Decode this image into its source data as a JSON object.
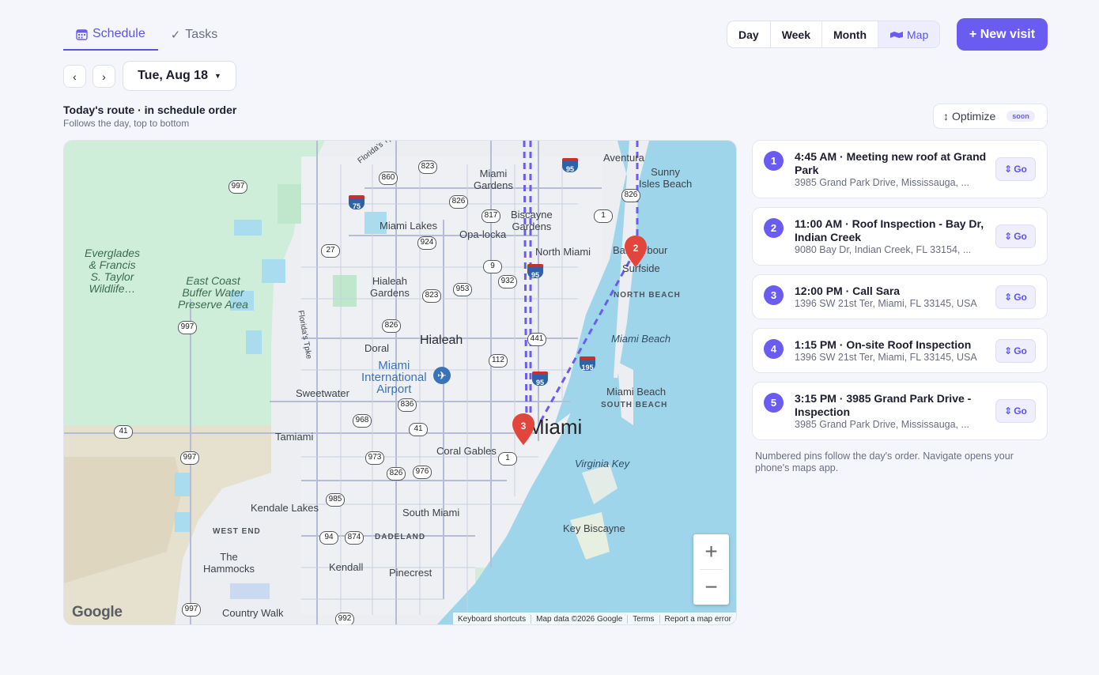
{
  "tabs": [
    {
      "label": "Schedule",
      "icon": "calendar-icon",
      "active": true
    },
    {
      "label": "Tasks",
      "icon": "check-icon",
      "active": false
    }
  ],
  "views": [
    {
      "label": "Day"
    },
    {
      "label": "Week"
    },
    {
      "label": "Month"
    },
    {
      "label": "Map",
      "icon": "map-icon",
      "active": true
    }
  ],
  "new_visit_label": "+ New visit",
  "date": {
    "label": "Tue, Aug 18",
    "prev": "‹",
    "next": "›"
  },
  "route": {
    "title": "Today's route · in schedule order",
    "subtitle": "Follows the day, top to bottom"
  },
  "optimize": {
    "label": "Optimize",
    "badge": "soon"
  },
  "map": {
    "labels": {
      "everglades": "Everglades\n& Francis\nS. Taylor\nWildlife…",
      "east_coast": "East Coast\nBuffer Water\nPreserve Area",
      "miami_gardens": "Miami\nGardens",
      "biscayne_gardens": "Biscayne\nGardens",
      "aventura": "Aventura",
      "sunny_isles": "Sunny\nIsles Beach",
      "miami_lakes": "Miami Lakes",
      "opa_locka": "Opa-locka",
      "north_miami": "North Miami",
      "bal_harbour": "Bal Harbour",
      "surfside": "Surfside",
      "north_beach": "NORTH BEACH",
      "hialeah_gardens": "Hialeah\nGardens",
      "hialeah": "Hialeah",
      "doral": "Doral",
      "miami_beach_water": "Miami Beach",
      "airport": "Miami\nInternational\nAirport",
      "sweetwater": "Sweetwater",
      "miami_beach": "Miami Beach",
      "south_beach": "SOUTH BEACH",
      "tamiami": "Tamiami",
      "miami": "Miami",
      "coral_gables": "Coral Gables",
      "virginia_key": "Virginia Key",
      "kendale_lakes": "Kendale Lakes",
      "south_miami": "South Miami",
      "west_end": "WEST END",
      "dadeland": "DADELAND",
      "key_biscayne": "Key Biscayne",
      "the_hammocks": "The\nHammocks",
      "kendall": "Kendall",
      "pinecrest": "Pinecrest",
      "country_walk": "Country Walk",
      "florida_tpke_1": "Florida's Tpk",
      "florida_tpke_2": "Florida's Tpke"
    },
    "shields": [
      "997",
      "860",
      "823",
      "826",
      "817",
      "27",
      "924",
      "9",
      "932",
      "953",
      "823",
      "826",
      "441",
      "112",
      "836",
      "968",
      "41",
      "41",
      "997",
      "973",
      "826",
      "976",
      "1",
      "985",
      "94",
      "874",
      "997",
      "992",
      "997",
      "826",
      "1"
    ],
    "interstates": [
      "95",
      "75",
      "95",
      "195",
      "95"
    ],
    "pins": [
      "2",
      "3"
    ],
    "zoom_in": "+",
    "zoom_out": "−",
    "google": "Google",
    "attribution": [
      "Keyboard shortcuts",
      "Map data ©2026 Google",
      "Terms",
      "Report a map error"
    ]
  },
  "visits": [
    {
      "num": "1",
      "title": "4:45 AM · Meeting new roof at Grand Park",
      "address": "3985 Grand Park Drive, Mississauga, ...",
      "go": "Go"
    },
    {
      "num": "2",
      "title": "11:00 AM · Roof Inspection - Bay Dr, Indian Creek",
      "address": "9080 Bay Dr, Indian Creek, FL 33154, ...",
      "go": "Go"
    },
    {
      "num": "3",
      "title": "12:00 PM · Call Sara",
      "address": "1396 SW 21st Ter, Miami, FL 33145, USA",
      "go": "Go"
    },
    {
      "num": "4",
      "title": "1:15 PM · On-site Roof Inspection",
      "address": "1396 SW 21st Ter, Miami, FL 33145, USA",
      "go": "Go"
    },
    {
      "num": "5",
      "title": "3:15 PM · 3985 Grand Park Drive - Inspection",
      "address": "3985 Grand Park Drive, Mississauga, ...",
      "go": "Go"
    }
  ],
  "hint": "Numbered pins follow the day's order. Navigate opens your phone's maps app.",
  "colors": {
    "accent": "#6a5cf0",
    "pin": "#e2453c",
    "water": "#9fd5ea",
    "park": "#c7ebd2"
  }
}
